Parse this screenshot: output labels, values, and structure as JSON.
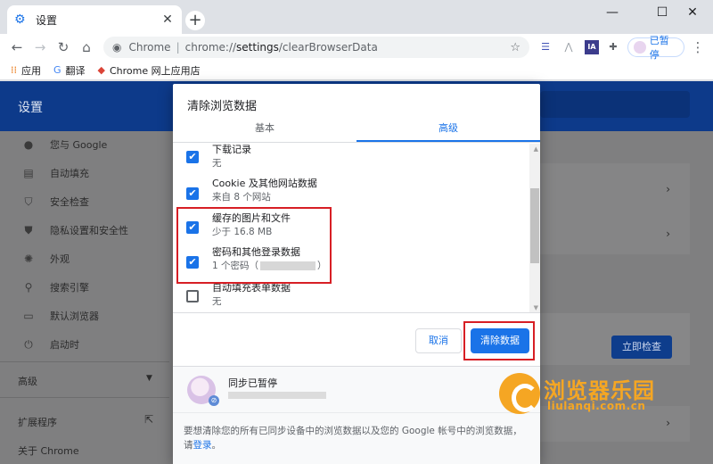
{
  "browser": {
    "tab_title": "设置",
    "new_tab": "+",
    "omnibox": {
      "scheme": "Chrome",
      "separator": "|",
      "host": "chrome://",
      "host_bold": "settings",
      "path": "/clearBrowserData"
    },
    "profile_label": "已暂停",
    "bookmarks": [
      {
        "icon": "apps-grid-icon",
        "label": "应用"
      },
      {
        "icon": "translate-icon",
        "label": "翻译"
      },
      {
        "icon": "webstore-icon",
        "label": "Chrome 网上应用店"
      }
    ],
    "colors": {
      "accent": "#1a73e8",
      "header": "#0d3a8a"
    }
  },
  "settings": {
    "header_title": "设置",
    "sidebar": [
      {
        "icon": "person-icon",
        "label": "您与 Google"
      },
      {
        "icon": "clipboard-icon",
        "label": "自动填充"
      },
      {
        "icon": "shield-icon",
        "label": "安全检查"
      },
      {
        "icon": "shield-lock-icon",
        "label": "隐私设置和安全性"
      },
      {
        "icon": "palette-icon",
        "label": "外观"
      },
      {
        "icon": "search-icon",
        "label": "搜索引擎"
      },
      {
        "icon": "browser-icon",
        "label": "默认浏览器"
      },
      {
        "icon": "power-icon",
        "label": "启动时"
      }
    ],
    "advanced_label": "高级",
    "extensions_label": "扩展程序",
    "about_label": "关于 Chrome",
    "check_now_label": "立即检查"
  },
  "dialog": {
    "title": "清除浏览数据",
    "tabs": [
      {
        "label": "基本",
        "active": false
      },
      {
        "label": "高级",
        "active": true
      }
    ],
    "options": [
      {
        "label": "下载记录",
        "sub": "无",
        "checked": true
      },
      {
        "label": "Cookie 及其他网站数据",
        "sub": "来自 8 个网站",
        "checked": true
      },
      {
        "label": "缓存的图片和文件",
        "sub": "少于 16.8 MB",
        "checked": true
      },
      {
        "label": "密码和其他登录数据",
        "sub_prefix": "1 个密码（",
        "sub_suffix": "）",
        "checked": true
      },
      {
        "label": "自动填充表单数据",
        "sub": "无",
        "checked": false
      }
    ],
    "cancel_label": "取消",
    "clear_label": "清除数据",
    "sync_status": "同步已暂停",
    "footer_text": "要想清除您的所有已同步设备中的浏览数据以及您的 Google 帐号中的浏览数据，请",
    "footer_link": "登录",
    "footer_end": "。"
  },
  "watermark": {
    "text": "浏览器乐园",
    "url": "liulanqi.com.cn"
  }
}
